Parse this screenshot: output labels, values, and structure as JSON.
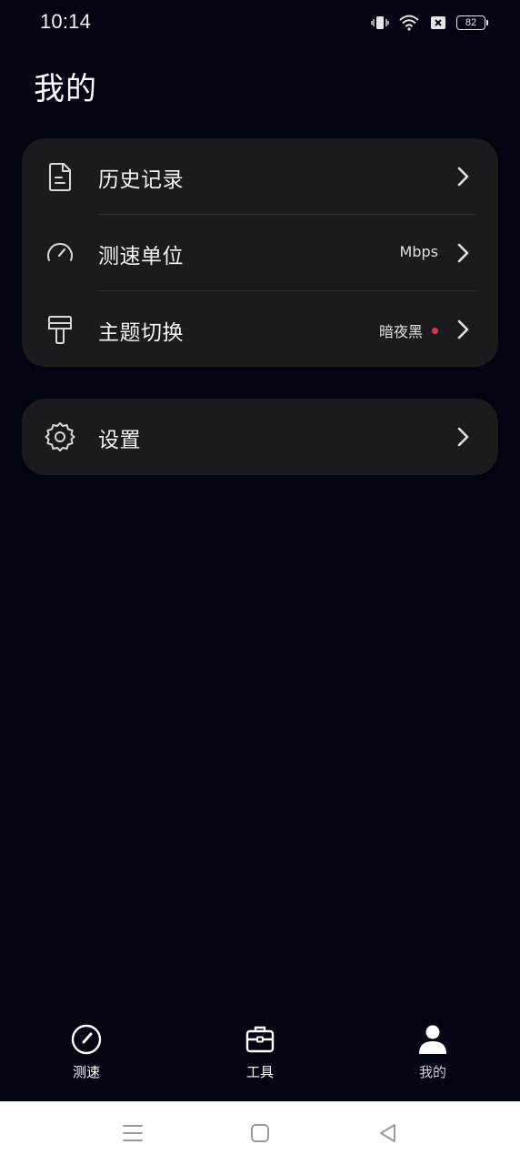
{
  "status_bar": {
    "time": "10:14",
    "battery_level": "82",
    "icons": [
      "vibrate-icon",
      "wifi-icon",
      "sim-off-icon",
      "battery-icon"
    ]
  },
  "page": {
    "title": "我的"
  },
  "menu_card": {
    "items": [
      {
        "label": "历史记录",
        "value": "",
        "icon": "document-icon"
      },
      {
        "label": "测速单位",
        "value": "Mbps",
        "icon": "speedometer-icon"
      },
      {
        "label": "主题切换",
        "value": "暗夜黑",
        "icon": "paint-brush-icon",
        "badge_color": "#e8304d"
      }
    ]
  },
  "settings_card": {
    "label": "设置",
    "icon": "gear-icon"
  },
  "tab_bar": {
    "tabs": [
      {
        "label": "测速",
        "icon": "speedometer-icon"
      },
      {
        "label": "工具",
        "icon": "toolbox-icon"
      },
      {
        "label": "我的",
        "icon": "person-icon",
        "active": true
      }
    ]
  },
  "nav_bar": {
    "buttons": [
      "menu-icon",
      "home-icon",
      "back-icon"
    ]
  },
  "colors": {
    "background": "#020412",
    "card": "#1b1b1f",
    "accent_red": "#e8304d"
  }
}
